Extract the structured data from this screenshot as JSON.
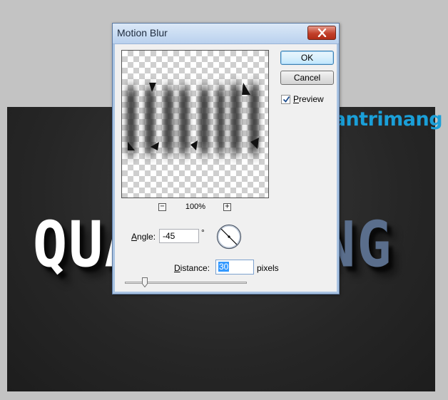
{
  "canvas": {
    "text_left": "QUA",
    "text_right": "ANG",
    "watermark": "uantrimang"
  },
  "dialog": {
    "title": "Motion Blur",
    "ok_label": "OK",
    "cancel_label": "Cancel",
    "preview_label": "Preview",
    "preview_checked": true,
    "zoom_out_symbol": "−",
    "zoom_in_symbol": "+",
    "zoom_level": "100%",
    "angle_label": "Angle:",
    "angle_value": "-45",
    "angle_unit": "°",
    "distance_label": "Distance:",
    "distance_value": "30",
    "distance_unit": "pixels"
  },
  "icons": [
    "close-icon",
    "checkmark-icon",
    "angle-dial-icon",
    "slider-thumb-icon"
  ],
  "colors": {
    "accent": "#3399ff",
    "close_red": "#c2402b",
    "text_blue": "#5a6e8c",
    "watermark_blue": "#1a9fd8"
  }
}
